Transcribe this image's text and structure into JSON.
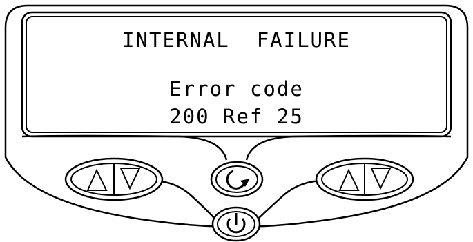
{
  "display": {
    "line1": "INTERNAL  FAILURE",
    "line2": "Error code",
    "line3": "200 Ref 25"
  },
  "controls": {
    "left_pair": [
      "up-arrow-icon",
      "down-arrow-icon"
    ],
    "center": "refresh-icon",
    "power": "power-icon",
    "right_pair": [
      "up-arrow-icon",
      "down-arrow-icon"
    ]
  },
  "colors": {
    "stroke": "#000000",
    "background": "#ffffff"
  }
}
